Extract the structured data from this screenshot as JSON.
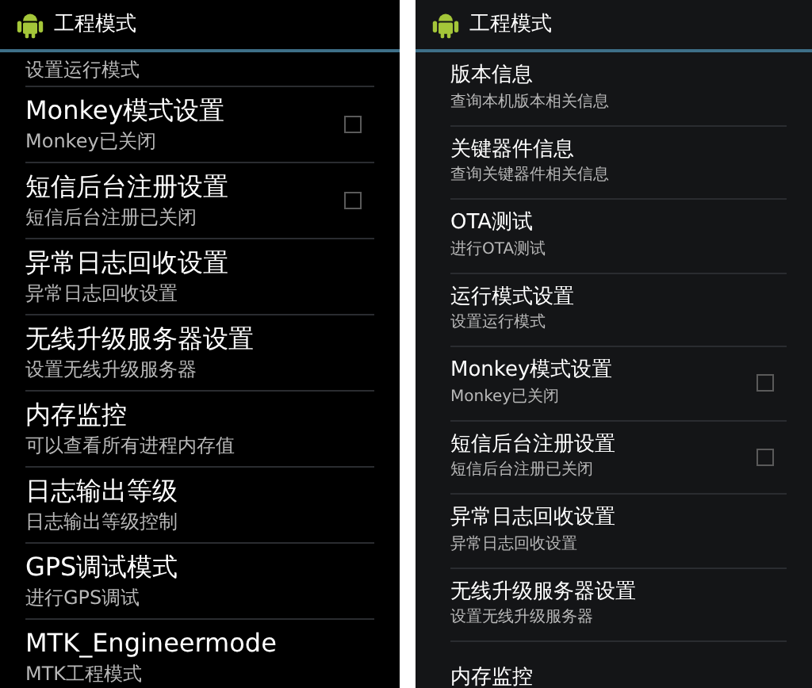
{
  "panels": [
    {
      "title": "工程模式",
      "items": [
        {
          "kind": "plain",
          "subtitle": "设置运行模式"
        },
        {
          "kind": "checkbox",
          "title": "Monkey模式设置",
          "subtitle": "Monkey已关闭",
          "checked": false
        },
        {
          "kind": "checkbox",
          "title": "短信后台注册设置",
          "subtitle": "短信后台注册已关闭",
          "checked": false
        },
        {
          "kind": "plain",
          "title": "异常日志回收设置",
          "subtitle": "异常日志回收设置"
        },
        {
          "kind": "plain",
          "title": "无线升级服务器设置",
          "subtitle": "设置无线升级服务器"
        },
        {
          "kind": "plain",
          "title": "内存监控",
          "subtitle": "可以查看所有进程内存值"
        },
        {
          "kind": "plain",
          "title": "日志输出等级",
          "subtitle": "日志输出等级控制"
        },
        {
          "kind": "plain",
          "title": "GPS调试模式",
          "subtitle": "进行GPS调试"
        },
        {
          "kind": "plain",
          "title": "MTK_Engineermode",
          "subtitle": "MTK工程模式"
        }
      ]
    },
    {
      "title": "工程模式",
      "items": [
        {
          "kind": "plain",
          "title": "版本信息",
          "subtitle": "查询本机版本相关信息"
        },
        {
          "kind": "plain",
          "title": "关键器件信息",
          "subtitle": "查询关键器件相关信息"
        },
        {
          "kind": "plain",
          "title": "OTA测试",
          "subtitle": "进行OTA测试"
        },
        {
          "kind": "plain",
          "title": "运行模式设置",
          "subtitle": "设置运行模式"
        },
        {
          "kind": "checkbox",
          "title": "Monkey模式设置",
          "subtitle": "Monkey已关闭",
          "checked": false
        },
        {
          "kind": "checkbox",
          "title": "短信后台注册设置",
          "subtitle": "短信后台注册已关闭",
          "checked": false
        },
        {
          "kind": "plain",
          "title": "异常日志回收设置",
          "subtitle": "异常日志回收设置"
        },
        {
          "kind": "plain",
          "title": "无线升级服务器设置",
          "subtitle": "设置无线升级服务器"
        },
        {
          "kind": "plain",
          "title": "内存监控"
        }
      ]
    }
  ]
}
